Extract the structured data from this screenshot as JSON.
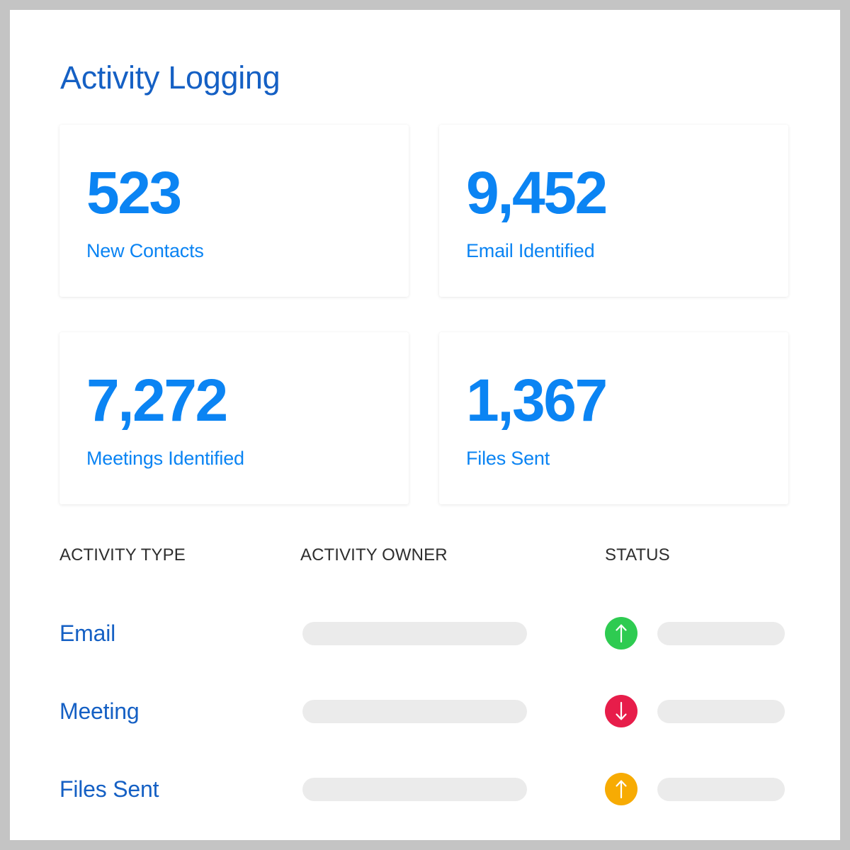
{
  "page": {
    "title": "Activity Logging",
    "title_color": "#1560c4",
    "background": "#ffffff",
    "frame_color": "#c4c4c4"
  },
  "stats": {
    "accent_color": "#0b84f3",
    "cards": [
      {
        "value": "523",
        "label": "New Contacts"
      },
      {
        "value": "9,452",
        "label": "Email Identified"
      },
      {
        "value": "7,272",
        "label": "Meetings Identified"
      },
      {
        "value": "1,367",
        "label": "Files Sent"
      }
    ]
  },
  "table": {
    "headers": {
      "type": "ACTIVITY TYPE",
      "owner": "ACTIVITY OWNER",
      "status": "STATUS"
    },
    "header_color": "#2e2e2e",
    "row_label_color": "#1560c4",
    "placeholder_color": "#ebebeb",
    "rows": [
      {
        "type": "Email",
        "owner": "",
        "status_icon": "arrow-up-icon",
        "status_direction": "up",
        "status_color": "#2ecb51"
      },
      {
        "type": "Meeting",
        "owner": "",
        "status_icon": "arrow-down-icon",
        "status_direction": "down",
        "status_color": "#e71d4a"
      },
      {
        "type": "Files Sent",
        "owner": "",
        "status_icon": "arrow-up-icon",
        "status_direction": "up",
        "status_color": "#f7ab03"
      }
    ]
  }
}
